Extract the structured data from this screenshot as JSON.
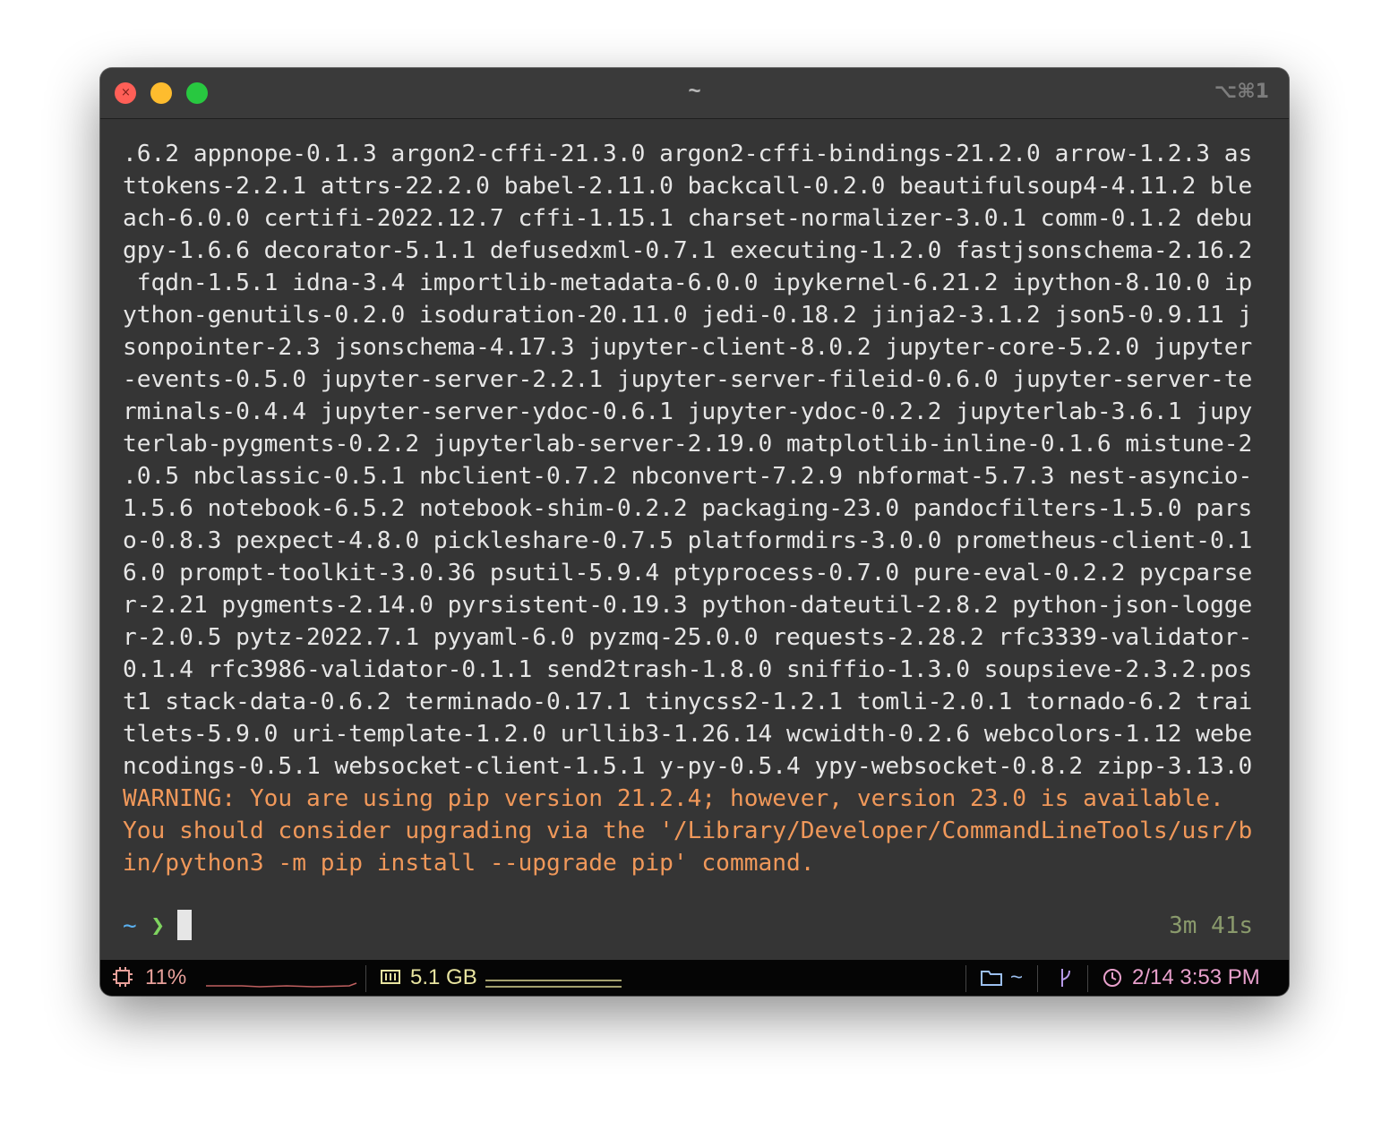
{
  "window": {
    "title": "~",
    "shortcut": "⌥⌘1",
    "close_glyph": "×"
  },
  "terminal": {
    "output_lines": [
      ".6.2 appnope-0.1.3 argon2-cffi-21.3.0 argon2-cffi-bindings-21.2.0 arrow-1.2.3 as",
      "ttokens-2.2.1 attrs-22.2.0 babel-2.11.0 backcall-0.2.0 beautifulsoup4-4.11.2 ble",
      "ach-6.0.0 certifi-2022.12.7 cffi-1.15.1 charset-normalizer-3.0.1 comm-0.1.2 debu",
      "gpy-1.6.6 decorator-5.1.1 defusedxml-0.7.1 executing-1.2.0 fastjsonschema-2.16.2",
      " fqdn-1.5.1 idna-3.4 importlib-metadata-6.0.0 ipykernel-6.21.2 ipython-8.10.0 ip",
      "ython-genutils-0.2.0 isoduration-20.11.0 jedi-0.18.2 jinja2-3.1.2 json5-0.9.11 j",
      "sonpointer-2.3 jsonschema-4.17.3 jupyter-client-8.0.2 jupyter-core-5.2.0 jupyter",
      "-events-0.5.0 jupyter-server-2.2.1 jupyter-server-fileid-0.6.0 jupyter-server-te",
      "rminals-0.4.4 jupyter-server-ydoc-0.6.1 jupyter-ydoc-0.2.2 jupyterlab-3.6.1 jupy",
      "terlab-pygments-0.2.2 jupyterlab-server-2.19.0 matplotlib-inline-0.1.6 mistune-2",
      ".0.5 nbclassic-0.5.1 nbclient-0.7.2 nbconvert-7.2.9 nbformat-5.7.3 nest-asyncio-",
      "1.5.6 notebook-6.5.2 notebook-shim-0.2.2 packaging-23.0 pandocfilters-1.5.0 pars",
      "o-0.8.3 pexpect-4.8.0 pickleshare-0.7.5 platformdirs-3.0.0 prometheus-client-0.1",
      "6.0 prompt-toolkit-3.0.36 psutil-5.9.4 ptyprocess-0.7.0 pure-eval-0.2.2 pycparse",
      "r-2.21 pygments-2.14.0 pyrsistent-0.19.3 python-dateutil-2.8.2 python-json-logge",
      "r-2.0.5 pytz-2022.7.1 pyyaml-6.0 pyzmq-25.0.0 requests-2.28.2 rfc3339-validator-",
      "0.1.4 rfc3986-validator-0.1.1 send2trash-1.8.0 sniffio-1.3.0 soupsieve-2.3.2.pos",
      "t1 stack-data-0.6.2 terminado-0.17.1 tinycss2-1.2.1 tomli-2.0.1 tornado-6.2 trai",
      "tlets-5.9.0 uri-template-1.2.0 urllib3-1.26.14 wcwidth-0.2.6 webcolors-1.12 webe",
      "ncodings-0.5.1 websocket-client-1.5.1 y-py-0.5.4 ypy-websocket-0.8.2 zipp-3.13.0"
    ],
    "warning_lines": [
      "WARNING: You are using pip version 21.2.4; however, version 23.0 is available.",
      "You should consider upgrading via the '/Library/Developer/CommandLineTools/usr/b",
      "in/python3 -m pip install --upgrade pip' command."
    ],
    "prompt": {
      "directory": "~",
      "symbol": "❯"
    },
    "elapsed": "3m 41s"
  },
  "statusbar": {
    "cpu": "11%",
    "memory": "5.1 GB",
    "directory": "~",
    "datetime": "2/14 3:53 PM"
  },
  "colors": {
    "warning": "#f0985a",
    "prompt_dir": "#5ab0f0",
    "prompt_symbol": "#7ed35f",
    "cpu": "#e8a09a",
    "memory": "#e8e4a0",
    "directory": "#9cc0f0",
    "clock": "#e8a0cc"
  }
}
